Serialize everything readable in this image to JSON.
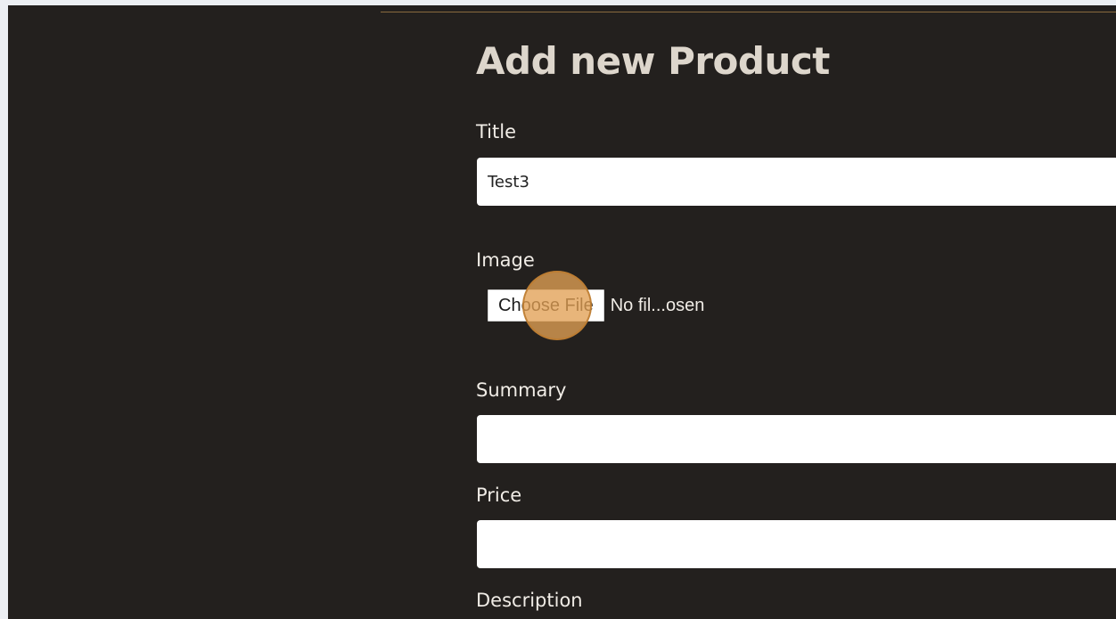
{
  "page": {
    "title": "Add new Product"
  },
  "form": {
    "title_field": {
      "label": "Title",
      "value": "Test3",
      "placeholder": ""
    },
    "image_field": {
      "label": "Image",
      "button_label": "Choose File",
      "status_text": "No fil...osen"
    },
    "summary_field": {
      "label": "Summary",
      "value": "",
      "placeholder": ""
    },
    "price_field": {
      "label": "Price",
      "value": "",
      "placeholder": ""
    },
    "description_field": {
      "label": "Description"
    }
  },
  "theme": {
    "page_background": "#eceff3",
    "panel_background": "#23201e",
    "accent_rule": "#8a6a3e",
    "title_color": "#ddd6cc",
    "label_color": "#f0ece6",
    "click_marker": "#e1a055"
  }
}
